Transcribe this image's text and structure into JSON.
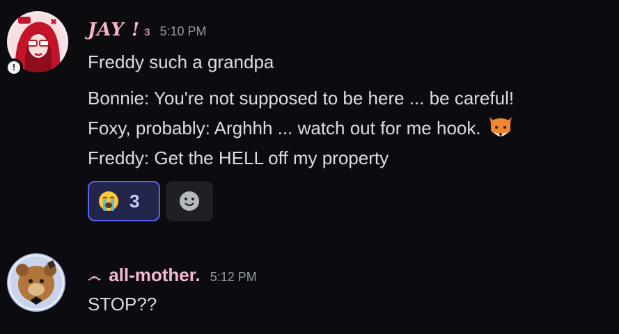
{
  "messages": [
    {
      "username": "JAY",
      "username_suffix": "!",
      "username_deco": "ɜ",
      "username_color": "#f3b7c9",
      "timestamp": "5:10 PM",
      "lines": [
        "Freddy such a grandpa",
        "Bonnie: You're not supposed to be here ... be careful!",
        "Foxy, probably: Arghhh ... watch out for me hook.",
        "Freddy: Get the HELL off my property"
      ],
      "status_badge": "!",
      "inline_emoji": "fox-emoji",
      "reactions": [
        {
          "emoji": "loudly-crying-face",
          "count": "3",
          "active": true
        },
        {
          "emoji": "add-reaction-smiley",
          "count": "",
          "active": false
        }
      ]
    },
    {
      "username": "all-mother.",
      "username_prefix": "෴",
      "username_color": "#f5b8d3",
      "timestamp": "5:12 PM",
      "lines": [
        "STOP??"
      ]
    }
  ],
  "colors": {
    "background": "#0c0b0f",
    "text": "#dbdee1",
    "timestamp": "#949ba4",
    "reaction_active_bg": "#23264a",
    "reaction_active_border": "#5865f2"
  }
}
